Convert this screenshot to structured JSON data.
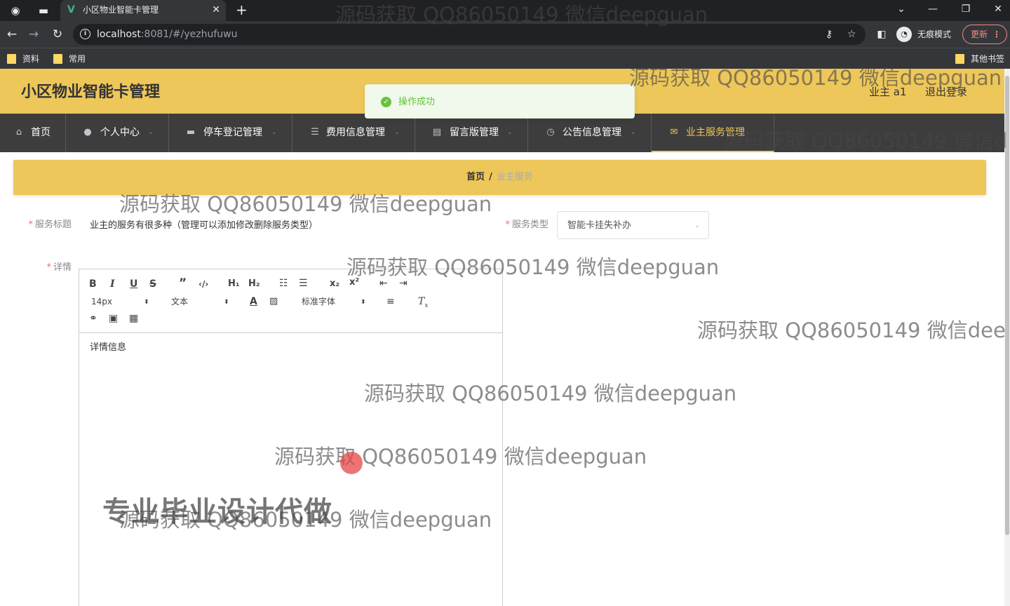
{
  "browser": {
    "tab_title": "小区物业智能卡管理",
    "url_host": "localhost",
    "url_path": ":8081/#/yezhufuwu",
    "incognito_label": "无痕模式",
    "update_label": "更新",
    "bookmarks": [
      "资料",
      "常用"
    ],
    "other_bookmarks": "其他书签"
  },
  "header": {
    "app_title": "小区物业智能卡管理",
    "user_label": "业主 a1",
    "logout_label": "退出登录"
  },
  "toast": {
    "message": "操作成功"
  },
  "menu": {
    "items": [
      {
        "label": "首页",
        "icon": "home-icon"
      },
      {
        "label": "个人中心",
        "icon": "user-icon"
      },
      {
        "label": "停车登记管理",
        "icon": "briefcase-icon"
      },
      {
        "label": "费用信息管理",
        "icon": "list-icon"
      },
      {
        "label": "留言版管理",
        "icon": "document-icon"
      },
      {
        "label": "公告信息管理",
        "icon": "clock-icon"
      },
      {
        "label": "业主服务管理",
        "icon": "mail-icon"
      }
    ],
    "active_index": 6
  },
  "breadcrumb": {
    "home": "首页",
    "separator": "/",
    "current": "业主服务"
  },
  "form": {
    "service_title_label": "服务标题",
    "service_title_value": "业主的服务有很多种（管理可以添加修改删除服务类型）",
    "service_type_label": "服务类型",
    "service_type_value": "智能卡挂失补办",
    "detail_label": "详情"
  },
  "editor": {
    "font_size": "14px",
    "text_type": "文本",
    "font_family": "标准字体",
    "content": "详情信息"
  },
  "watermarks": {
    "text": "源码获取 QQ86050149 微信deepguan",
    "partial_1": "源码获取 QQ86050149 微信d",
    "partial_2": "源码获取 QQ86050149 微信dee",
    "big": "专业毕业设计代做"
  },
  "colors": {
    "accent": "#eec75a",
    "menu_bg": "#3d3d3d",
    "success": "#67c23a",
    "required": "#f56c6c"
  }
}
